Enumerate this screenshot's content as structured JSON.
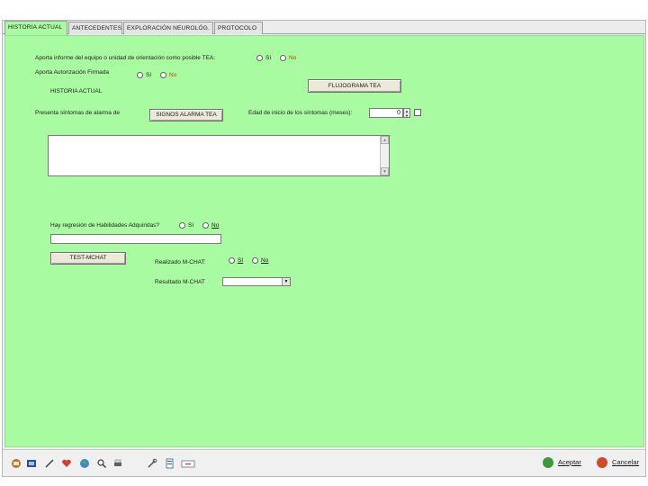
{
  "tabs": [
    {
      "label": "HISTORIA ACTUAL",
      "active": true
    },
    {
      "label": "ANTECEDENTES",
      "active": false
    },
    {
      "label": "EXPLORACIÓN NEUROLÓG.",
      "active": false
    },
    {
      "label": "PROTOCOLO",
      "active": false
    }
  ],
  "form": {
    "informe_question": "Aporta informe del equipo o unidad de orientación como posible TEA:",
    "informe_si": "Sí",
    "informe_no": "No",
    "autorizacion_question": "Aporta Autorización Firmada",
    "autorizacion_si": "Sí",
    "autorizacion_no": "No",
    "flujograma_button": "FLUJOGRAMA TEA",
    "section_title": "HISTORIA ACTUAL",
    "signos_label": "Presenta síntomas de alarma de",
    "signos_button": "SIGNOS ALARMA TEA",
    "edad_label": "Edad de inicio de los síntomas (meses):",
    "edad_value": "0",
    "regresion_question": "Hay regresión de Habilidades Adquiridas?",
    "regresion_si": "Sí",
    "regresion_no": "No",
    "mchat_button": "TEST-MCHAT",
    "realizado_label": "Realizado M-CHAT:",
    "realizado_si": "Sí",
    "realizado_no": "No",
    "resultado_label": "Resultado M-CHAT",
    "resultado_value": ""
  },
  "toolbar": {
    "icons": [
      "save-icon",
      "preview-icon",
      "edit-icon",
      "heart-icon",
      "globe-icon",
      "search-icon",
      "print-icon",
      "tools-icon",
      "document-icon",
      "minus-icon"
    ],
    "accept_label": "Aceptar",
    "cancel_label": "Cancelar"
  },
  "colors": {
    "panel_bg": "#a9fba1",
    "accept_icon": "#3c9a3c",
    "cancel_icon": "#d04a2a"
  }
}
